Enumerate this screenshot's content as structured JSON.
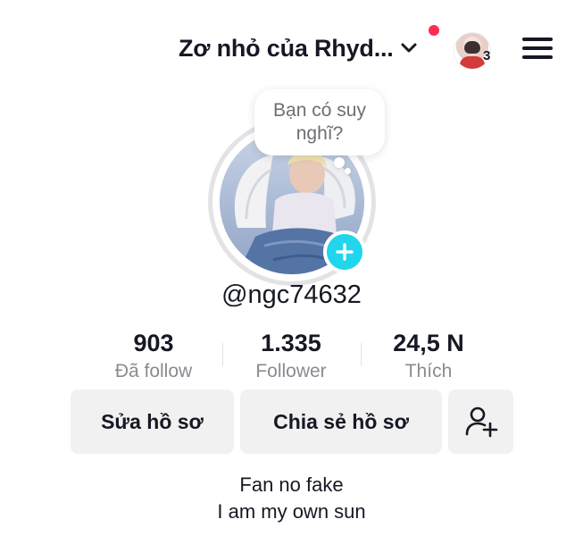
{
  "header": {
    "account_name": "Zơ nhỏ của Rhyd...",
    "notification_count": "3"
  },
  "avatar_prompt": "Bạn có suy nghĩ?",
  "profile": {
    "username": "@ngc74632"
  },
  "stats": [
    {
      "value": "903",
      "label": "Đã follow"
    },
    {
      "value": "1.335",
      "label": "Follower"
    },
    {
      "value": "24,5 N",
      "label": "Thích"
    }
  ],
  "actions": {
    "edit_profile": "Sửa hồ sơ",
    "share_profile": "Chia sẻ hồ sơ"
  },
  "bio": [
    "Fan no fake",
    "I am my own sun"
  ],
  "colors": {
    "accent_cyan": "#20d5ec",
    "notification_red": "#fe2c55",
    "button_bg": "#f1f1f2"
  }
}
